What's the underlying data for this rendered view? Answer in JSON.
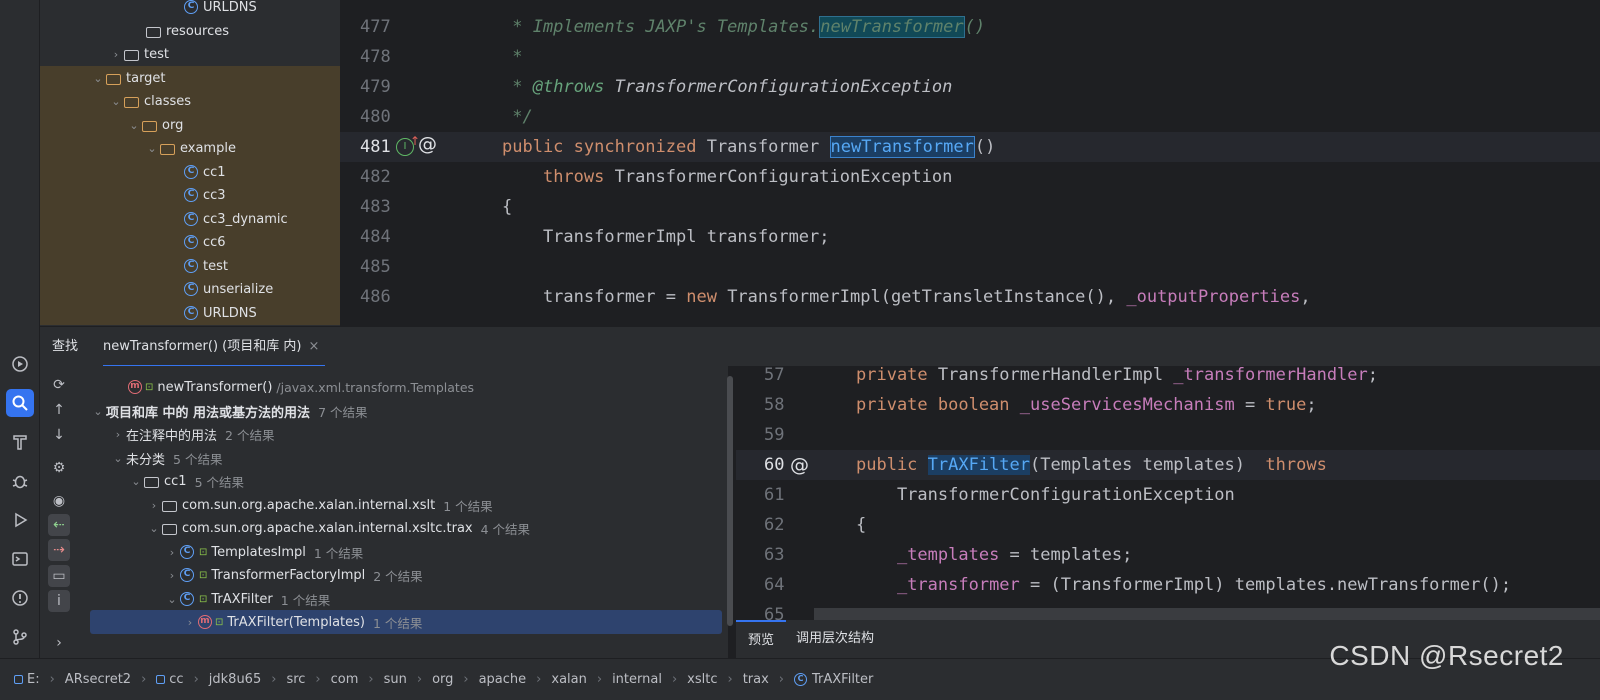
{
  "project_tree": {
    "items": [
      {
        "label": "URLDNS",
        "kind": "class"
      },
      {
        "label": "resources",
        "kind": "folder"
      },
      {
        "label": "test",
        "kind": "folder"
      },
      {
        "label": "target",
        "kind": "folder-orange"
      },
      {
        "label": "classes",
        "kind": "folder-orange"
      },
      {
        "label": "org",
        "kind": "folder-orange"
      },
      {
        "label": "example",
        "kind": "folder-orange"
      },
      {
        "label": "cc1",
        "kind": "class"
      },
      {
        "label": "cc3",
        "kind": "class"
      },
      {
        "label": "cc3_dynamic",
        "kind": "class"
      },
      {
        "label": "cc6",
        "kind": "class"
      },
      {
        "label": "test",
        "kind": "class"
      },
      {
        "label": "unserialize",
        "kind": "class"
      },
      {
        "label": "URLDNS",
        "kind": "class"
      }
    ]
  },
  "editor_top": {
    "lines": [
      {
        "num": "477",
        "code": " * Implements JAXP's Templates.newTransformer()"
      },
      {
        "num": "478",
        "code": " *"
      },
      {
        "num": "479",
        "code": " * @throws TransformerConfigurationException"
      },
      {
        "num": "480",
        "code": " */"
      },
      {
        "num": "481",
        "code": "public synchronized Transformer newTransformer()"
      },
      {
        "num": "482",
        "code": "    throws TransformerConfigurationException"
      },
      {
        "num": "483",
        "code": "{"
      },
      {
        "num": "484",
        "code": "    TransformerImpl transformer;"
      },
      {
        "num": "485",
        "code": ""
      },
      {
        "num": "486",
        "code": "    transformer = new TransformerImpl(getTransletInstance(), _outputProperties,"
      }
    ]
  },
  "find_panel": {
    "title": "查找",
    "tab_label": "newTransformer() (项目和库 内)",
    "close": "×"
  },
  "results": {
    "target_method": "newTransformer()",
    "target_path": "/javax.xml.transform.Templates",
    "usages_label": "项目和库 中的 用法或基方法的用法",
    "usages_count": "7 个结果",
    "in_comments_label": "在注释中的用法",
    "in_comments_count": "2 个结果",
    "unclassified_label": "未分类",
    "unclassified_count": "5 个结果",
    "cc1_label": "cc1",
    "cc1_count": "5 个结果",
    "pkg_xslt": "com.sun.org.apache.xalan.internal.xslt",
    "pkg_xslt_count": "1 个结果",
    "pkg_trax": "com.sun.org.apache.xalan.internal.xsltc.trax",
    "pkg_trax_count": "4 个结果",
    "templates_impl": "TemplatesImpl",
    "templates_impl_count": "1 个结果",
    "factory_impl": "TransformerFactoryImpl",
    "factory_impl_count": "2 个结果",
    "trax_filter": "TrAXFilter",
    "trax_filter_count": "1 个结果",
    "trax_filter_ctor": "TrAXFilter(Templates)",
    "trax_filter_ctor_count": "1 个结果"
  },
  "preview": {
    "lines": [
      {
        "num": "57",
        "code": "private TransformerHandlerImpl _transformerHandler;"
      },
      {
        "num": "58",
        "code": "private boolean _useServicesMechanism = true;"
      },
      {
        "num": "59",
        "code": ""
      },
      {
        "num": "60",
        "code": "public TrAXFilter(Templates templates)  throws"
      },
      {
        "num": "61",
        "code": "    TransformerConfigurationException"
      },
      {
        "num": "62",
        "code": "{"
      },
      {
        "num": "63",
        "code": "    _templates = templates;"
      },
      {
        "num": "64",
        "code": "    _transformer = (TransformerImpl) templates.newTransformer();"
      }
    ],
    "footer_tabs": [
      "预览",
      "调用层次结构"
    ]
  },
  "breadcrumb": [
    "E:",
    "ARsecret2",
    "cc",
    "jdk8u65",
    "src",
    "com",
    "sun",
    "org",
    "apache",
    "xalan",
    "internal",
    "xsltc",
    "trax",
    "TrAXFilter"
  ],
  "watermark": "CSDN @Rsecret2",
  "colors": {
    "accent": "#3574f0",
    "keyword": "#cf8e6d",
    "doc": "#5f826b",
    "field": "#c77dbb",
    "method": "#56a8f5"
  }
}
